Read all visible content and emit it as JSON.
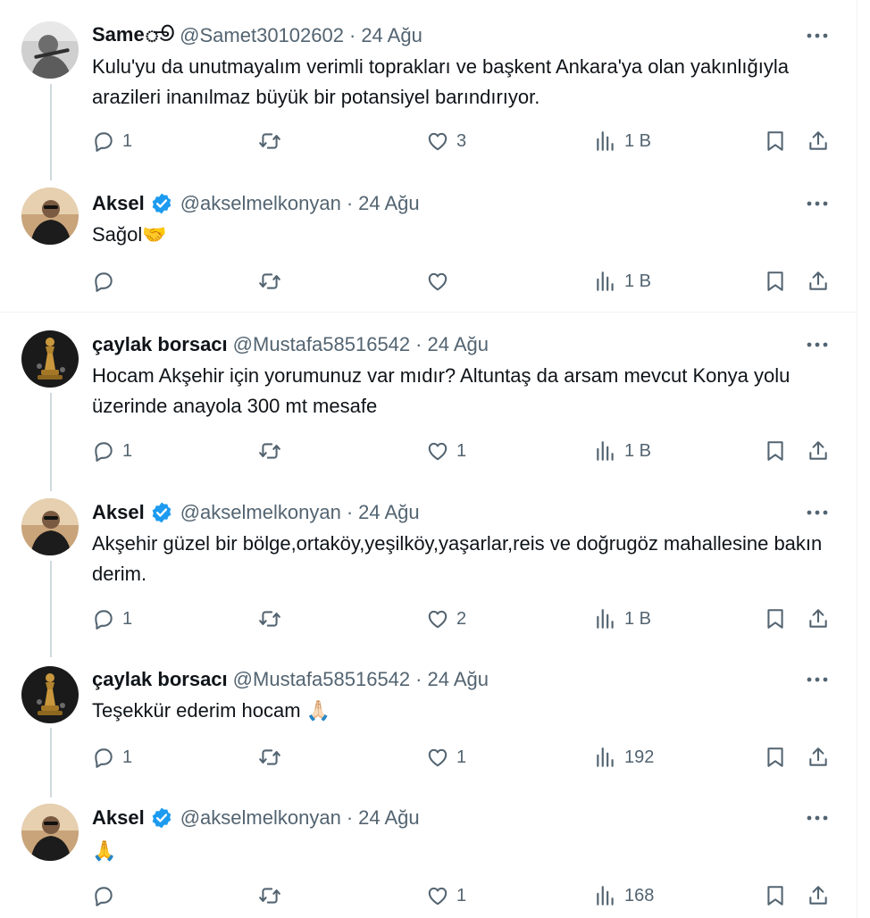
{
  "tweets": [
    {
      "name": "Sameூ",
      "verified": false,
      "handle": "@Samet30102602",
      "date": "24 Ağu",
      "text": "Kulu'yu da unutmayalım verimli toprakları ve başkent Ankara'ya olan yakınlığıyla arazileri inanılmaz büyük bir potansiyel barındırıyor.",
      "replies": "1",
      "retweets": "",
      "likes": "3",
      "views": "1 B"
    },
    {
      "name": "Aksel",
      "verified": true,
      "handle": "@akselmelkonyan",
      "date": "24 Ağu",
      "text": "Sağol🤝",
      "replies": "",
      "retweets": "",
      "likes": "",
      "views": "1 B"
    },
    {
      "name": "çaylak borsacı",
      "verified": false,
      "handle": "@Mustafa58516542",
      "date": "24 Ağu",
      "text": "Hocam Akşehir için yorumunuz var mıdır? Altuntaş da arsam mevcut Konya yolu üzerinde anayola 300 mt mesafe",
      "replies": "1",
      "retweets": "",
      "likes": "1",
      "views": "1 B"
    },
    {
      "name": "Aksel",
      "verified": true,
      "handle": "@akselmelkonyan",
      "date": "24 Ağu",
      "text": "Akşehir güzel bir bölge,ortaköy,yeşilköy,yaşarlar,reis ve doğrugöz mahallesine bakın derim.",
      "replies": "1",
      "retweets": "",
      "likes": "2",
      "views": "1 B"
    },
    {
      "name": "çaylak borsacı",
      "verified": false,
      "handle": "@Mustafa58516542",
      "date": "24 Ağu",
      "text": "Teşekkür ederim hocam 🙏🏻",
      "replies": "1",
      "retweets": "",
      "likes": "1",
      "views": "192"
    },
    {
      "name": "Aksel",
      "verified": true,
      "handle": "@akselmelkonyan",
      "date": "24 Ağu",
      "text": "🙏",
      "replies": "",
      "retweets": "",
      "likes": "1",
      "views": "168"
    }
  ],
  "colors": {
    "text": "#0f1419",
    "secondary": "#536471",
    "verified": "#1d9bf0",
    "thread_line": "#cfd9de",
    "separator": "#eff3f4"
  }
}
